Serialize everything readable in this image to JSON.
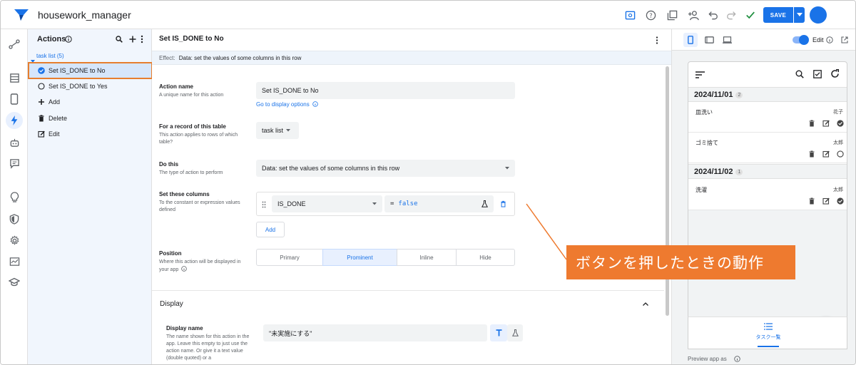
{
  "app": {
    "title": "housework_manager"
  },
  "toolbar": {
    "save_label": "SAVE"
  },
  "actions_panel": {
    "title": "Actions",
    "group_label": "task list (5)",
    "items": [
      {
        "label": "Set IS_DONE to No"
      },
      {
        "label": "Set IS_DONE to Yes"
      },
      {
        "label": "Add"
      },
      {
        "label": "Delete"
      },
      {
        "label": "Edit"
      }
    ]
  },
  "editor": {
    "title": "Set IS_DONE to No",
    "effect_label": "Effect:",
    "effect_value": "Data: set the values of some columns in this row",
    "action_name_label": "Action name",
    "action_name_sub": "A unique name for this action",
    "action_name_value": "Set IS_DONE to No",
    "display_options_link": "Go to display options",
    "table_label": "For a record of this table",
    "table_sub": "This action applies to rows of which table?",
    "table_value": "task list",
    "do_this_label": "Do this",
    "do_this_sub": "The type of action to perform",
    "do_this_value": "Data: set the values of some columns in this row",
    "set_cols_label": "Set these columns",
    "set_cols_sub": "To the constant or expression values defined",
    "column_value": "IS_DONE",
    "expr_eq": "=",
    "expr_value": "false",
    "add_label": "Add",
    "position_label": "Position",
    "position_sub": "Where this action will be displayed in your app",
    "positions": [
      "Primary",
      "Prominent",
      "Inline",
      "Hide"
    ],
    "display_section": "Display",
    "display_name_label": "Display name",
    "display_name_sub": "The name shown for this action in the app. Leave this empty to just use the action name. Or give it a text value (double quoted) or a",
    "display_name_value": "\"未実施にする\""
  },
  "preview": {
    "edit_label": "Edit",
    "days": [
      {
        "date": "2024/11/01",
        "count": "2"
      },
      {
        "date": "2024/11/02",
        "count": "1"
      }
    ],
    "tasks": [
      {
        "name": "皿洗い",
        "who": "花子"
      },
      {
        "name": "ゴミ捨て",
        "who": "太郎"
      },
      {
        "name": "洗濯",
        "who": "太郎"
      }
    ],
    "nav_label": "タスク一覧",
    "footer": "Preview app as"
  },
  "callout": {
    "text": "ボタンを押したときの動作"
  },
  "colors": {
    "accent": "#1a73e8",
    "callout": "#ee7a2f",
    "selection_border": "#e67e2e"
  }
}
